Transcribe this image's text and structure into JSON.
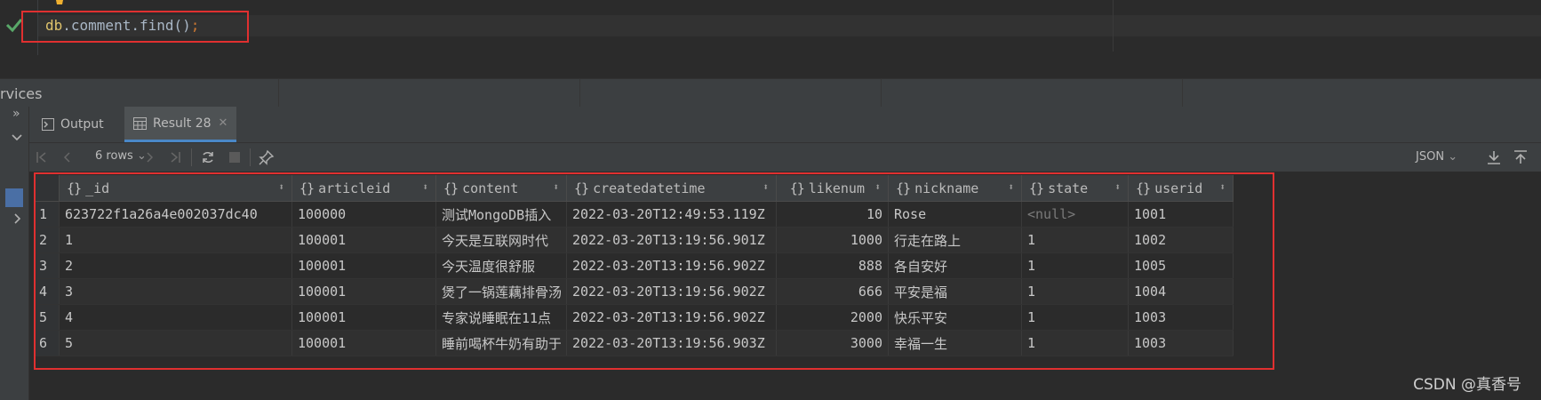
{
  "editor": {
    "code": {
      "db": "db",
      "rest": ".comment.find()",
      "semicolon": ";"
    }
  },
  "services": {
    "label": "rvices"
  },
  "tabs": [
    {
      "label": "Output"
    },
    {
      "label": "Result 28"
    }
  ],
  "toolbar": {
    "rows_label": "6 rows",
    "format_label": "JSON"
  },
  "table": {
    "columns": [
      {
        "label": "_id"
      },
      {
        "label": "articleid"
      },
      {
        "label": "content"
      },
      {
        "label": "createdatetime"
      },
      {
        "label": "likenum"
      },
      {
        "label": "nickname"
      },
      {
        "label": "state"
      },
      {
        "label": "userid"
      }
    ],
    "rows": [
      {
        "n": "1",
        "_id": "623722f1a26a4e002037dc40",
        "articleid": "100000",
        "content": "测试MongoDB插入",
        "createdatetime": "2022-03-20T12:49:53.119Z",
        "likenum": "10",
        "nickname": "Rose",
        "state": "<null>",
        "userid": "1001"
      },
      {
        "n": "2",
        "_id": "1",
        "articleid": "100001",
        "content": "今天是互联网时代",
        "createdatetime": "2022-03-20T13:19:56.901Z",
        "likenum": "1000",
        "nickname": "行走在路上",
        "state": "1",
        "userid": "1002"
      },
      {
        "n": "3",
        "_id": "2",
        "articleid": "100001",
        "content": "今天温度很舒服",
        "createdatetime": "2022-03-20T13:19:56.902Z",
        "likenum": "888",
        "nickname": "各自安好",
        "state": "1",
        "userid": "1005"
      },
      {
        "n": "4",
        "_id": "3",
        "articleid": "100001",
        "content": "煲了一锅莲藕排骨汤",
        "createdatetime": "2022-03-20T13:19:56.902Z",
        "likenum": "666",
        "nickname": "平安是福",
        "state": "1",
        "userid": "1004"
      },
      {
        "n": "5",
        "_id": "4",
        "articleid": "100001",
        "content": "专家说睡眠在11点",
        "createdatetime": "2022-03-20T13:19:56.902Z",
        "likenum": "2000",
        "nickname": "快乐平安",
        "state": "1",
        "userid": "1003"
      },
      {
        "n": "6",
        "_id": "5",
        "articleid": "100001",
        "content": "睡前喝杯牛奶有助于",
        "createdatetime": "2022-03-20T13:19:56.903Z",
        "likenum": "3000",
        "nickname": "幸福一生",
        "state": "1",
        "userid": "1003"
      }
    ]
  },
  "watermark": "CSDN @真香号",
  "colors": {
    "highlight": "#e03030",
    "selected_row_marker": "#4a6fa5",
    "tab_underline": "#4a88c7"
  },
  "icons": [
    "check-icon",
    "lightbulb-icon",
    "output-icon",
    "table-icon",
    "close-icon",
    "first-page-icon",
    "prev-page-icon",
    "next-page-icon",
    "last-page-icon",
    "reload-icon",
    "stop-icon",
    "pin-icon",
    "download-icon",
    "upload-icon"
  ]
}
